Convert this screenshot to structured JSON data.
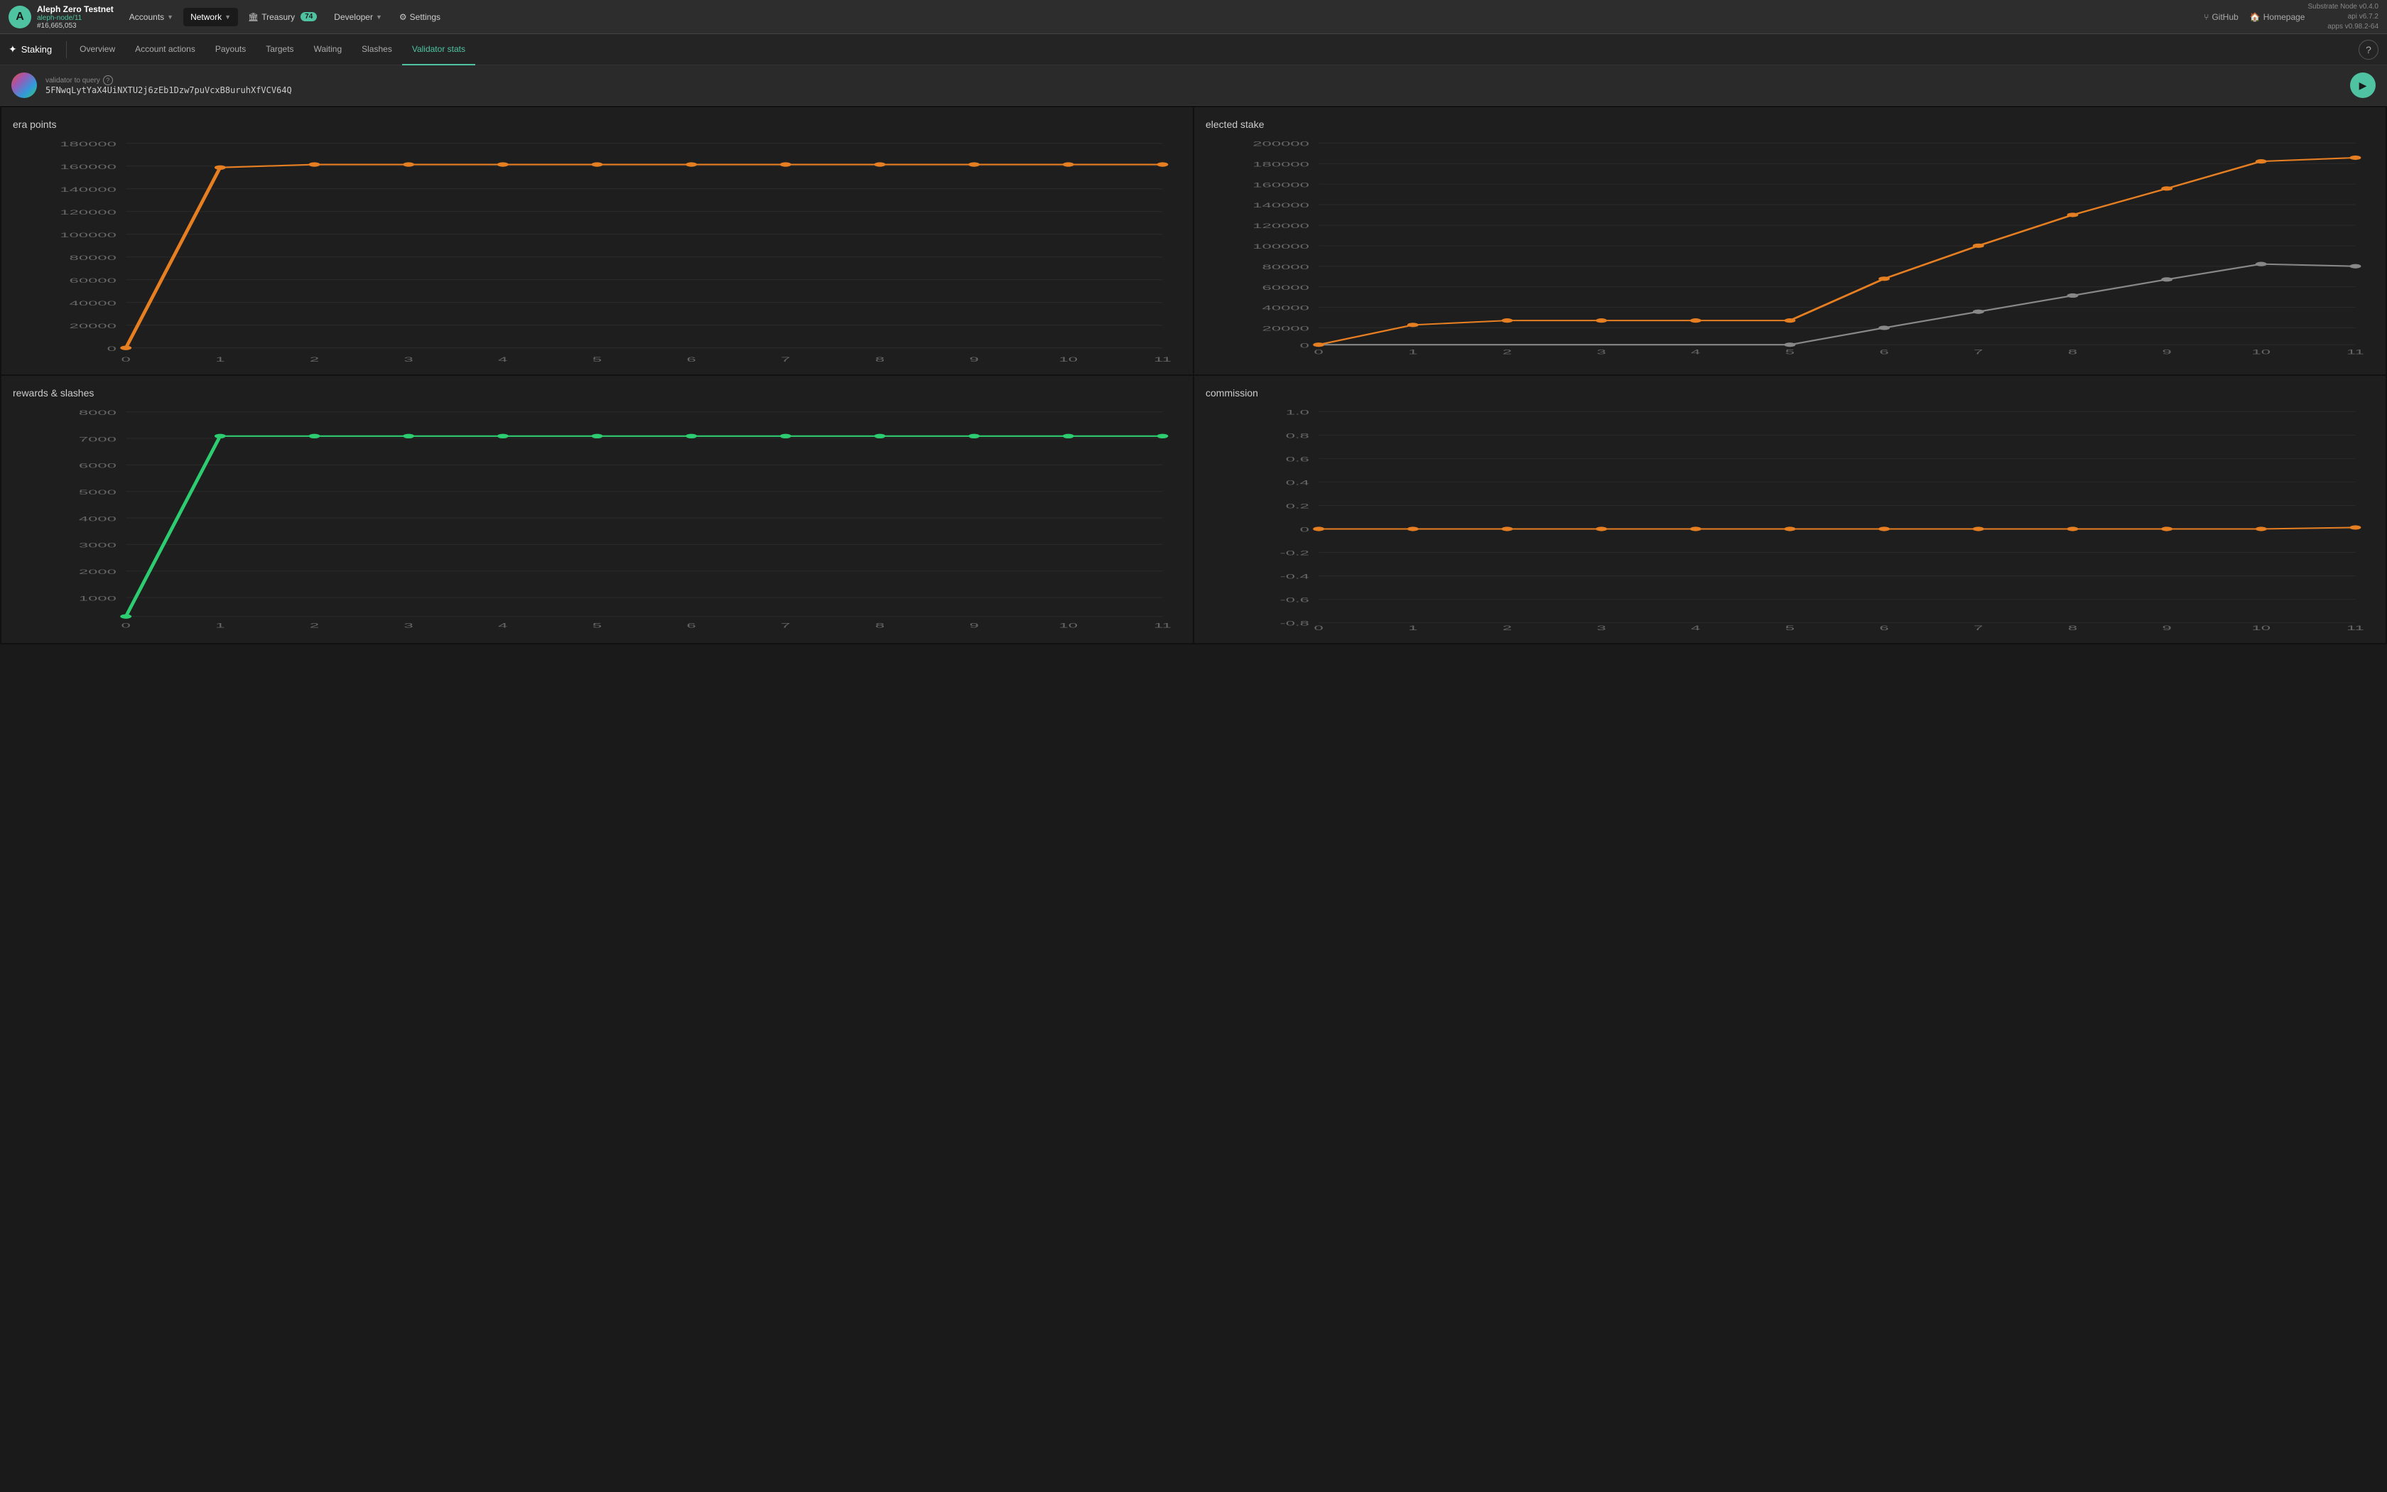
{
  "app": {
    "logo_text": "A",
    "network_name": "Aleph Zero Testnet",
    "network_node": "aleph-node/11",
    "block": "#16,665,053",
    "version": "Substrate Node v0.4.0",
    "api": "api v6.7.2",
    "apps": "apps v0.98.2-64"
  },
  "topnav": {
    "accounts": "Accounts",
    "network": "Network",
    "treasury": "Treasury",
    "treasury_count": "74",
    "developer": "Developer",
    "settings": "Settings",
    "github": "GitHub",
    "homepage": "Homepage"
  },
  "staking": {
    "label": "Staking",
    "tabs": [
      {
        "id": "overview",
        "label": "Overview"
      },
      {
        "id": "account-actions",
        "label": "Account actions"
      },
      {
        "id": "payouts",
        "label": "Payouts"
      },
      {
        "id": "targets",
        "label": "Targets"
      },
      {
        "id": "waiting",
        "label": "Waiting"
      },
      {
        "id": "slashes",
        "label": "Slashes"
      },
      {
        "id": "validator-stats",
        "label": "Validator stats"
      }
    ]
  },
  "validator": {
    "label": "validator to query",
    "address": "5FNwqLytYaX4UiNXTU2j6zEb1Dzw7puVcxB8uruhXfVCV64Q"
  },
  "charts": {
    "era_points": {
      "title": "era points",
      "y_labels": [
        "180000",
        "160000",
        "140000",
        "120000",
        "100000",
        "80000",
        "60000",
        "40000",
        "20000",
        "0"
      ],
      "x_labels": [
        "0",
        "1",
        "2",
        "3",
        "4",
        "5",
        "6",
        "7",
        "8",
        "9",
        "10",
        "11"
      ]
    },
    "elected_stake": {
      "title": "elected stake",
      "y_labels": [
        "200000",
        "180000",
        "160000",
        "140000",
        "120000",
        "100000",
        "80000",
        "60000",
        "40000",
        "20000",
        "0"
      ],
      "x_labels": [
        "0",
        "1",
        "2",
        "3",
        "4",
        "5",
        "6",
        "7",
        "8",
        "9",
        "10",
        "11"
      ]
    },
    "rewards_slashes": {
      "title": "rewards & slashes",
      "y_labels": [
        "8000",
        "7000",
        "6000",
        "5000",
        "4000",
        "3000",
        "2000",
        "1000"
      ],
      "x_labels": [
        "0",
        "1",
        "2",
        "3",
        "4",
        "5",
        "6",
        "7",
        "8",
        "9",
        "10",
        "11"
      ]
    },
    "commission": {
      "title": "commission",
      "y_labels": [
        "1.0",
        "0.8",
        "0.6",
        "0.4",
        "0.2",
        "0",
        "-0.2",
        "-0.4",
        "-0.6",
        "-0.8"
      ],
      "x_labels": [
        "0",
        "1",
        "2",
        "3",
        "4",
        "5",
        "6",
        "7",
        "8",
        "9",
        "10",
        "11"
      ]
    }
  }
}
